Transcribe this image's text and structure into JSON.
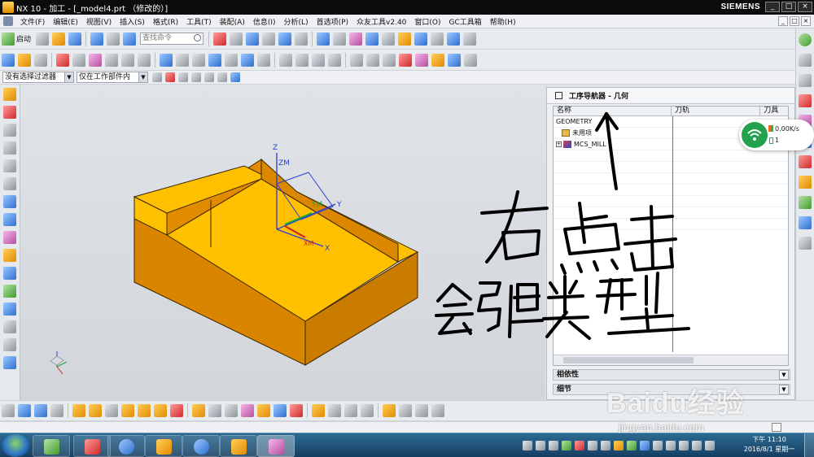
{
  "window": {
    "title": "NX 10 - 加工 - [_model4.prt （修改的）]",
    "brand": "SIEMENS",
    "controls": [
      "_",
      "□",
      "×"
    ]
  },
  "menubar": {
    "items": [
      "文件(F)",
      "编辑(E)",
      "视图(V)",
      "插入(S)",
      "格式(R)",
      "工具(T)",
      "装配(A)",
      "信息(I)",
      "分析(L)",
      "首选项(P)",
      "众友工具v2.40",
      "窗口(O)",
      "GC工具箱",
      "帮助(H)"
    ]
  },
  "toolbar": {
    "start_label": "启动",
    "search_placeholder": "查找命令"
  },
  "selection_bar": {
    "filter": "没有选择过滤器",
    "scope": "仅在工作部件内"
  },
  "viewport": {
    "axis_labels": {
      "z": "Z",
      "zm": "ZM",
      "ym": "YM",
      "y": "Y",
      "xm": "XM",
      "x": "X"
    },
    "model_color": "#f5a500"
  },
  "navigator": {
    "title": "工序导航器 - 几何",
    "columns": [
      "名称",
      "刀轨",
      "刀具"
    ],
    "rows": [
      {
        "label": "GEOMETRY",
        "indent": 0
      },
      {
        "label": "未用项",
        "indent": 1
      },
      {
        "label": "MCS_MILL",
        "indent": 1
      }
    ],
    "panels": [
      "相依性",
      "细节"
    ]
  },
  "net_widget": {
    "speed": "0.00K/s",
    "count": "1"
  },
  "annotation": {
    "line1": "右点击",
    "line2": "会弹类型"
  },
  "watermark": {
    "logo": "Baidu经验",
    "url": "jingyan.baidu.com"
  },
  "taskbar": {
    "time": "下午 11:10",
    "date": "2016/8/1 星期一"
  }
}
